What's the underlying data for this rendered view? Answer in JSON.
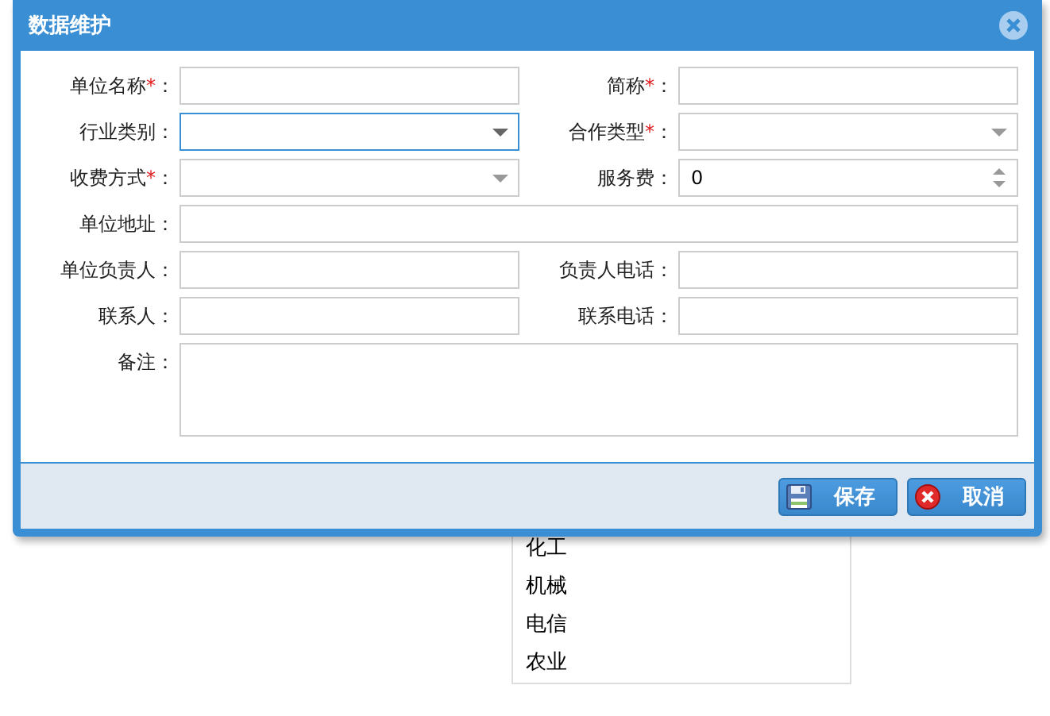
{
  "window": {
    "title": "数据维护"
  },
  "rows": [
    {
      "fields": [
        {
          "label": "单位名称",
          "required_mark": "*",
          "colon": "：",
          "kind": "text",
          "focused": false
        },
        {
          "label": "简称",
          "required_mark": "*",
          "colon": "：",
          "kind": "text",
          "focused": false
        }
      ]
    },
    {
      "fields": [
        {
          "label": "行业类别",
          "colon": "：",
          "kind": "select",
          "focused": true
        },
        {
          "label": "合作类型",
          "required_mark": "*",
          "colon": "：",
          "kind": "select",
          "focused": false
        }
      ]
    },
    {
      "fields": [
        {
          "label": "收费方式",
          "required_mark": "*",
          "colon": "：",
          "kind": "select",
          "focused": false
        },
        {
          "label": "服务费",
          "colon": "：",
          "kind": "number",
          "value": "0",
          "focused": false
        }
      ]
    },
    {
      "fields": [
        {
          "label": "单位地址",
          "colon": "：",
          "kind": "text",
          "wide": true,
          "focused": false
        }
      ]
    },
    {
      "fields": [
        {
          "label": "单位负责人",
          "colon": "：",
          "kind": "text",
          "focused": false
        },
        {
          "label": "负责人电话",
          "colon": "：",
          "kind": "text",
          "focused": false
        }
      ]
    },
    {
      "fields": [
        {
          "label": "联系人",
          "colon": "：",
          "kind": "text",
          "focused": false
        },
        {
          "label": "联系电话",
          "colon": "：",
          "kind": "text",
          "focused": false
        }
      ]
    },
    {
      "fields": [
        {
          "label": "备注",
          "colon": "：",
          "kind": "textarea",
          "wide": true,
          "focused": false
        }
      ]
    }
  ],
  "buttons": [
    {
      "label": "保存",
      "kind": "save"
    },
    {
      "label": "取消",
      "kind": "cancel"
    }
  ],
  "dropdown": {
    "items": [
      "化工",
      "机械",
      "电信",
      "农业"
    ]
  }
}
